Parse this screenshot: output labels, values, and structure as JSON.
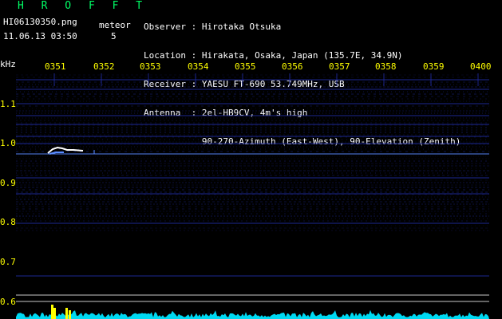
{
  "header": {
    "app_title": "H R O F F T",
    "filename": "HI06130350.png",
    "datetime": "11.06.13 03:50",
    "meteor_label": "meteor",
    "meteor_count": "5"
  },
  "station": {
    "rows": [
      {
        "label": "Observer ",
        "value": "Hirotaka Otsuka"
      },
      {
        "label": "Location ",
        "value": "Hirakata, Osaka, Japan (135.7E, 34.9N)"
      },
      {
        "label": "Receiver ",
        "value": "YAESU FT-690 53.749MHz, USB"
      },
      {
        "label": "Antenna  ",
        "value": "2el-HB9CV, 4m's high"
      },
      {
        "label": "         ",
        "value": "90-270-Azimuth (East-West), 90-Elevation (Zenith)"
      }
    ]
  },
  "plot": {
    "unit_label": "kHz",
    "time_ticks": [
      "0351",
      "0352",
      "0353",
      "0354",
      "0355",
      "0356",
      "0357",
      "0358",
      "0359",
      "0400"
    ],
    "freq_ticks": [
      "1.1",
      "1.0",
      "0.9",
      "0.8",
      "0.7",
      "0.6"
    ],
    "colors": {
      "background": "#000000",
      "grid": "#1e2a9a",
      "signal": "#5a8cff",
      "echo": "#ffffff",
      "noise_floor": "#00e5ff",
      "meteor_peak": "#ffff00",
      "reference_line": "#c8c8c8"
    }
  }
}
